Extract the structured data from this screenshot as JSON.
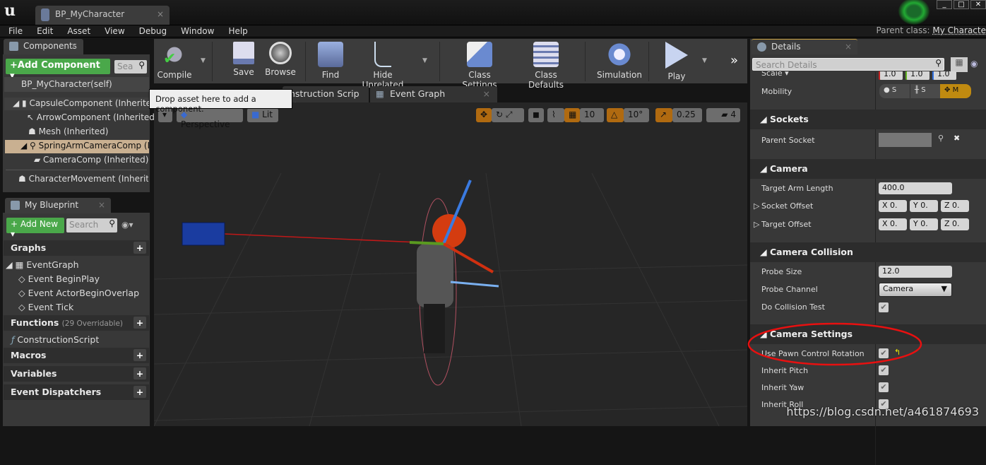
{
  "window": {
    "tab_title": "BP_MyCharacter",
    "parent_class_label": "Parent class:",
    "parent_class_value": "My Characte"
  },
  "menu": [
    "File",
    "Edit",
    "Asset",
    "View",
    "Debug",
    "Window",
    "Help"
  ],
  "components": {
    "tab": "Components",
    "add_button": "Add Component",
    "search_placeholder": "Sea",
    "self": "BP_MyCharacter(self)",
    "tree": [
      "CapsuleComponent (Inherited)",
      "ArrowComponent (Inherited)",
      "Mesh (Inherited)",
      "SpringArmCameraComp (Inh",
      "CameraComp (Inherited)",
      "CharacterMovement (Inherited"
    ],
    "selected_index": 3
  },
  "my_blueprint": {
    "tab": "My Blueprint",
    "add_button": "Add New",
    "search_placeholder": "Search",
    "graphs_label": "Graphs",
    "event_graph": "EventGraph",
    "events": [
      "Event BeginPlay",
      "Event ActorBeginOverlap",
      "Event Tick"
    ],
    "functions_label": "Functions",
    "functions_note": "(29 Overridable)",
    "construction_script": "ConstructionScript",
    "macros": "Macros",
    "variables": "Variables",
    "dispatchers": "Event Dispatchers"
  },
  "toolbar": {
    "compile": "Compile",
    "save": "Save",
    "browse": "Browse",
    "find": "Find",
    "hide_unrelated": "Hide Unrelated",
    "class_settings": "Class Settings",
    "class_defaults": "Class Defaults",
    "simulation": "Simulation",
    "play": "Play"
  },
  "editor_tabs": {
    "construction": "nstruction Scrip",
    "event_graph": "Event Graph"
  },
  "tooltip": "Drop asset here to add a component.",
  "viewport": {
    "perspective": "Perspective",
    "lit": "Lit",
    "grid_snap": "10",
    "rotation_snap": "10°",
    "scale_snap": "0.25",
    "camera_speed": "4"
  },
  "details": {
    "tab": "Details",
    "search_placeholder": "Search Details",
    "scale_label": "Scale",
    "scale_values": [
      "1.0",
      "1.0",
      "1.0"
    ],
    "mobility_label": "Mobility",
    "mobility_options": [
      "S",
      "S",
      "M"
    ],
    "mobility_selected": "M",
    "sockets": {
      "header": "Sockets",
      "parent_socket": "Parent Socket"
    },
    "camera": {
      "header": "Camera",
      "target_arm_length": "Target Arm Length",
      "target_arm_length_value": "400.0",
      "socket_offset": "Socket Offset",
      "target_offset": "Target Offset",
      "xyz": [
        "X",
        "0.",
        "Y",
        "0.",
        "Z",
        "0."
      ]
    },
    "collision": {
      "header": "Camera Collision",
      "probe_size": "Probe Size",
      "probe_size_value": "12.0",
      "probe_channel": "Probe Channel",
      "probe_channel_value": "Camera",
      "do_collision_test": "Do Collision Test",
      "do_collision_test_checked": true
    },
    "settings": {
      "header": "Camera Settings",
      "use_pawn_control_rotation": "Use Pawn Control Rotation",
      "inherit_pitch": "Inherit Pitch",
      "inherit_yaw": "Inherit Yaw",
      "inherit_roll": "Inherit Roll",
      "all_checked": true
    }
  },
  "annotation_color": "#e81010",
  "watermark": "https://blog.csdn.net/a461874693"
}
